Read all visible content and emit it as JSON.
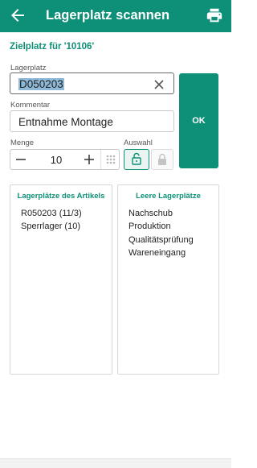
{
  "appbar": {
    "title": "Lagerplatz scannen",
    "back_icon": "arrow-left-icon",
    "print_icon": "printer-icon",
    "color": "#0e8f77"
  },
  "target": {
    "text": "Zielplatz für '10106'"
  },
  "lagerplatz": {
    "label": "Lagerplatz",
    "value": "D050203",
    "clear_icon": "close-icon"
  },
  "kommentar": {
    "label": "Kommentar",
    "value": "Entnahme Montage"
  },
  "menge": {
    "label": "Menge",
    "value": "10",
    "minus_icon": "minus-icon",
    "plus_icon": "plus-icon",
    "keypad_icon": "keypad-icon"
  },
  "auswahl": {
    "label": "Auswahl",
    "unlocked_icon": "lock-open-icon",
    "locked_icon": "lock-icon"
  },
  "ok_label": "OK",
  "article_locations": {
    "title": "Lagerplätze des Artikels",
    "items": [
      "R050203 (11/3)",
      "Sperrlager (10)"
    ]
  },
  "empty_locations": {
    "title": "Leere Lagerplätze",
    "items": [
      "Nachschub",
      "Produktion",
      "Qualitätsprüfung",
      "Wareneingang"
    ]
  }
}
